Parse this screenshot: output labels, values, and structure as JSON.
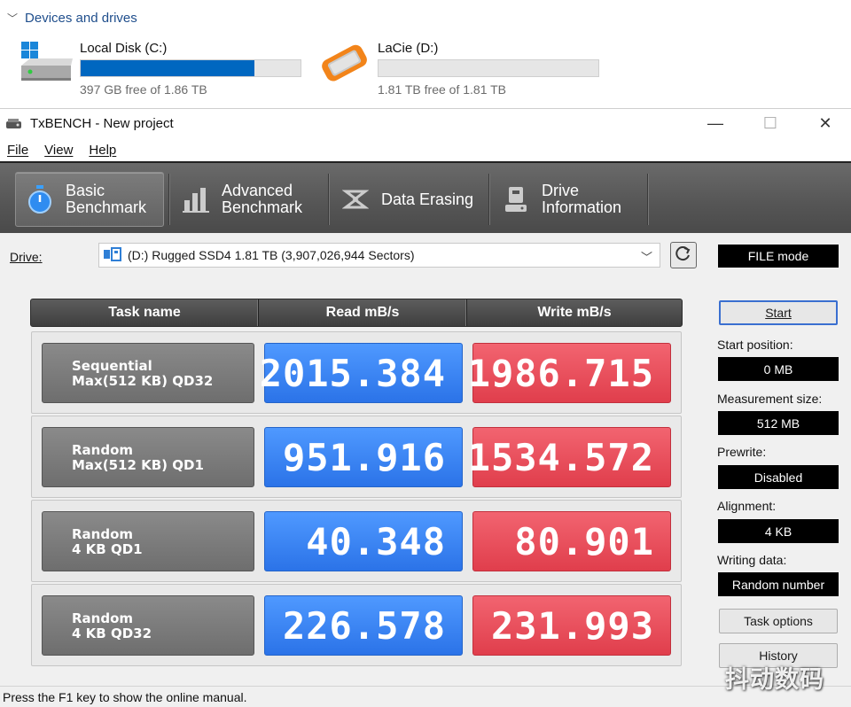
{
  "explorer": {
    "section_title": "Devices and drives",
    "drives": [
      {
        "name": "Local Disk (C:)",
        "free_text": "397 GB free of 1.86 TB",
        "used_fraction": 0.79,
        "icon": "hdd-windows-icon"
      },
      {
        "name": "LaCie (D:)",
        "free_text": "1.81 TB free of 1.81 TB",
        "used_fraction": 0.0,
        "icon": "lacie-rugged-drive-icon"
      }
    ]
  },
  "window": {
    "title": "TxBENCH - New project",
    "controls": {
      "minimize": "—",
      "maximize": "☐",
      "close": "✕"
    }
  },
  "menu": [
    "File",
    "View",
    "Help"
  ],
  "toolbar": {
    "tabs": [
      {
        "label_line1": "Basic",
        "label_line2": "Benchmark",
        "icon": "stopwatch-icon",
        "active": true
      },
      {
        "label_line1": "Advanced",
        "label_line2": "Benchmark",
        "icon": "bar-chart-icon",
        "active": false
      },
      {
        "label_line1": "Data Erasing",
        "label_line2": "",
        "icon": "eraser-icon",
        "active": false
      },
      {
        "label_line1": "Drive",
        "label_line2": "Information",
        "icon": "drive-info-icon",
        "active": false
      }
    ]
  },
  "drive_select": {
    "label": "Drive:",
    "value": "(D:) Rugged SSD4  1.81 TB (3,907,026,944 Sectors)",
    "mode": "FILE mode"
  },
  "grid": {
    "headers": [
      "Task name",
      "Read mB/s",
      "Write mB/s"
    ],
    "rows": [
      {
        "task_line1": "Sequential",
        "task_line2": "Max(512 KB) QD32",
        "read": "2015.384",
        "write": "1986.715"
      },
      {
        "task_line1": "Random",
        "task_line2": "Max(512 KB) QD1",
        "read": "951.916",
        "write": "1534.572"
      },
      {
        "task_line1": "Random",
        "task_line2": "4 KB QD1",
        "read": "40.348",
        "write": "80.901"
      },
      {
        "task_line1": "Random",
        "task_line2": "4 KB QD32",
        "read": "226.578",
        "write": "231.993"
      }
    ]
  },
  "panel": {
    "start": "Start",
    "start_position_label": "Start position:",
    "start_position": "0 MB",
    "measurement_size_label": "Measurement size:",
    "measurement_size": "512 MB",
    "prewrite_label": "Prewrite:",
    "prewrite": "Disabled",
    "alignment_label": "Alignment:",
    "alignment": "4 KB",
    "writing_data_label": "Writing data:",
    "writing_data": "Random number",
    "task_options": "Task options",
    "history": "History"
  },
  "status": "Press the F1 key to show the online manual.",
  "watermark": "抖动数码",
  "colors": {
    "read": "#2b73e8",
    "write": "#e03e4c",
    "drive_bar": "#0067c0"
  }
}
